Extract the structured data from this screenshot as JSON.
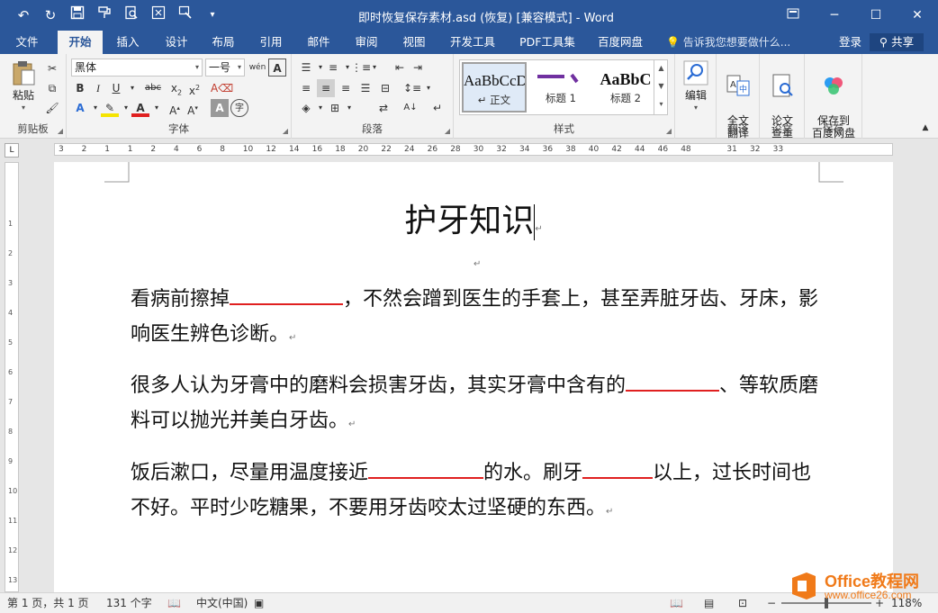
{
  "titlebar": {
    "title": "即时恢复保存素材.asd (恢复) [兼容模式] - Word",
    "qat_icons": [
      "undo-icon",
      "redo-icon",
      "save-icon",
      "format-painter-icon",
      "print-preview-icon",
      "touch-mode-icon",
      "customize-icon",
      "dropdown-icon"
    ]
  },
  "tabs": [
    "文件",
    "开始",
    "插入",
    "设计",
    "布局",
    "引用",
    "邮件",
    "审阅",
    "视图",
    "开发工具",
    "PDF工具集",
    "百度网盘"
  ],
  "tell_me": "告诉我您想要做什么...",
  "login": "登录",
  "share": "共享",
  "ribbon": {
    "clipboard": {
      "paste": "粘贴",
      "label": "剪贴板"
    },
    "font": {
      "name": "黑体",
      "size": "一号",
      "label": "字体"
    },
    "paragraph": {
      "label": "段落"
    },
    "styles": {
      "label": "样式",
      "items": [
        {
          "sample": "AaBbCcDd",
          "name": "↵ 正文"
        },
        {
          "sample": "",
          "name": "标题 1"
        },
        {
          "sample": "AaBbC",
          "name": "标题 2"
        }
      ]
    },
    "editing": {
      "label": "编辑"
    },
    "translate": {
      "button": "全文\n翻译",
      "label": "翻译"
    },
    "paper": {
      "button": "论文\n查重",
      "label": "论文"
    },
    "save": {
      "button": "保存到\n百度网盘",
      "label": "保存"
    }
  },
  "ruler_numbers": [
    "3",
    "2",
    "1",
    "1",
    "2",
    "4",
    "6",
    "8",
    "10",
    "12",
    "14",
    "16",
    "18",
    "20",
    "22",
    "24",
    "26",
    "28",
    "30",
    "32",
    "34",
    "36",
    "38",
    "40",
    "42",
    "44",
    "46",
    "48",
    "",
    "31",
    "32",
    "33"
  ],
  "document": {
    "heading": "护牙知识",
    "p1_a": "看病前擦掉",
    "p1_b": "，不然会蹭到医生的手套上，甚至弄脏牙齿、牙床，影响医生辨色诊断。",
    "p2_a": "很多人认为牙膏中的磨料会损害牙齿，其实牙膏中含有的",
    "p2_b": "、等软质磨料可以抛光并美白牙齿。",
    "p3_a": "饭后漱口，尽量用温度接近",
    "p3_b": "的水。刷牙",
    "p3_c": "以上，过长时间也不好。平时少吃糖果，不要用牙齿咬太过坚硬的东西。",
    "para_mark": "↵"
  },
  "status": {
    "page": "第 1 页，共 1 页",
    "words": "131 个字",
    "language": "中文(中国)",
    "zoom": "118%"
  },
  "watermark": {
    "brand": "Office教程网",
    "url": "www.office26.com"
  }
}
